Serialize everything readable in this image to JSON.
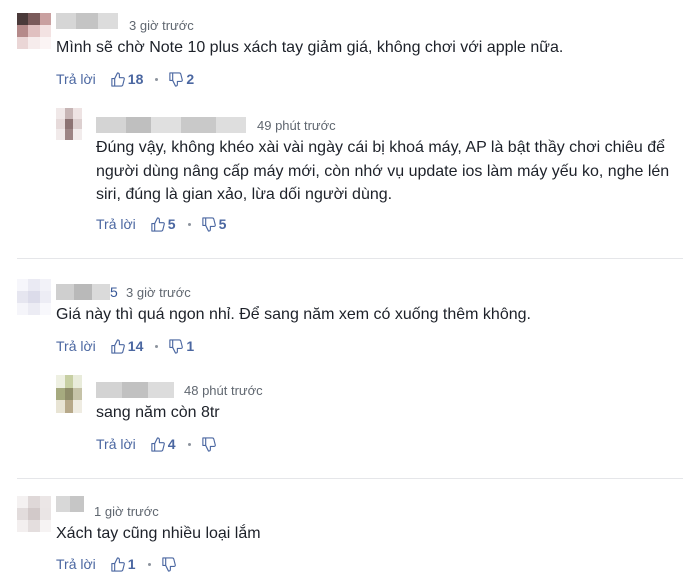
{
  "comments": [
    {
      "time": "3 giờ trước",
      "text": "Mình sẽ chờ Note 10 plus xách tay giảm giá, không chơi với apple nữa.",
      "reply": "Trả lời",
      "likes": "18",
      "dislikes": "2"
    },
    {
      "time": "49 phút trước",
      "text": "Đúng vậy, không khéo xài vài ngày cái bị khoá máy, AP là bật thầy chơi chiêu để người dùng nâng cấp máy mới, còn nhớ vụ update ios làm máy yếu ko, nghe lén siri, đúng là gian xảo, lừa dối người dùng.",
      "reply": "Trả lời",
      "likes": "5",
      "dislikes": "5"
    },
    {
      "time": "3 giờ trước",
      "text": "Giá này thì quá ngon nhỉ. Để sang năm xem có xuống thêm không.",
      "reply": "Trả lời",
      "likes": "14",
      "dislikes": "1",
      "name_suffix": "5"
    },
    {
      "time": "48 phút trước",
      "text": "sang năm còn 8tr",
      "reply": "Trả lời",
      "likes": "4",
      "dislikes": ""
    },
    {
      "time": "1 giờ trước",
      "text": "Xách tay cũng nhiều loại lắm",
      "reply": "Trả lời",
      "likes": "1",
      "dislikes": ""
    }
  ],
  "icons": {
    "like": "thumbs-up-icon",
    "dislike": "thumbs-down-icon"
  },
  "colors": {
    "link": "#4b67a1",
    "muted": "#606770",
    "text": "#1d2129"
  }
}
